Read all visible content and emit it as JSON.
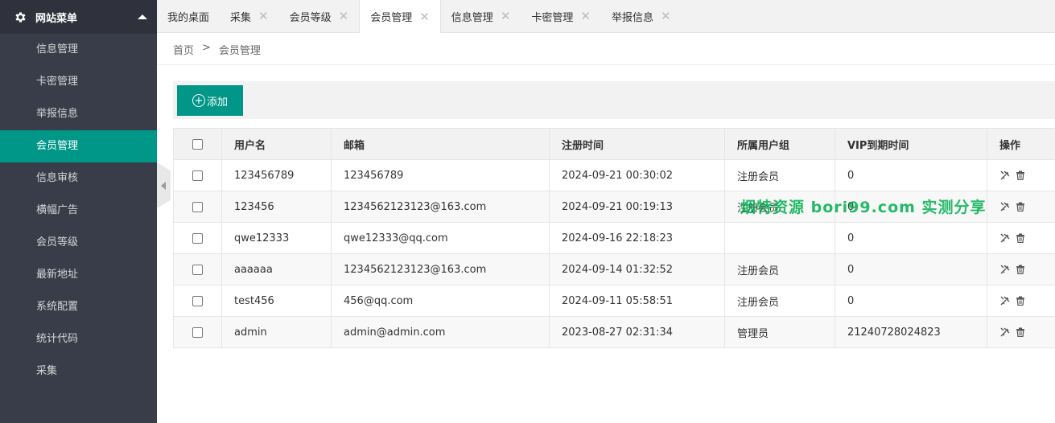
{
  "sidebar": {
    "header": "网站菜单",
    "items": [
      {
        "label": "信息管理",
        "active": false
      },
      {
        "label": "卡密管理",
        "active": false
      },
      {
        "label": "举报信息",
        "active": false
      },
      {
        "label": "会员管理",
        "active": true
      },
      {
        "label": "信息审核",
        "active": false
      },
      {
        "label": "横幅广告",
        "active": false
      },
      {
        "label": "会员等级",
        "active": false
      },
      {
        "label": "最新地址",
        "active": false
      },
      {
        "label": "系统配置",
        "active": false
      },
      {
        "label": "统计代码",
        "active": false
      },
      {
        "label": "采集",
        "active": false
      }
    ]
  },
  "tabs": [
    {
      "label": "我的桌面",
      "closable": false,
      "active": false
    },
    {
      "label": "采集",
      "closable": true,
      "active": false
    },
    {
      "label": "会员等级",
      "closable": true,
      "active": false
    },
    {
      "label": "会员管理",
      "closable": true,
      "active": true
    },
    {
      "label": "信息管理",
      "closable": true,
      "active": false
    },
    {
      "label": "卡密管理",
      "closable": true,
      "active": false
    },
    {
      "label": "举报信息",
      "closable": true,
      "active": false
    }
  ],
  "breadcrumb": {
    "home": "首页",
    "separator": ">",
    "current": "会员管理"
  },
  "toolbar": {
    "add_label": "添加"
  },
  "table": {
    "headers": {
      "username": "用户名",
      "email": "邮箱",
      "reg_time": "注册时间",
      "group": "所属用户组",
      "vip_expire": "VIP到期时间",
      "actions": "操作"
    },
    "rows": [
      {
        "username": "123456789",
        "email": "123456789",
        "reg_time": "2024-09-21 00:30:02",
        "group": "注册会员",
        "vip_expire": "0"
      },
      {
        "username": "123456",
        "email": "1234562123123@163.com",
        "reg_time": "2024-09-21 00:19:13",
        "group": "注册会员",
        "vip_expire": "0"
      },
      {
        "username": "qwe12333",
        "email": "qwe12333@qq.com",
        "reg_time": "2024-09-16 22:18:23",
        "group": "",
        "vip_expire": "0"
      },
      {
        "username": "aaaaaa",
        "email": "1234562123123@163.com",
        "reg_time": "2024-09-14 01:32:52",
        "group": "注册会员",
        "vip_expire": "0"
      },
      {
        "username": "test456",
        "email": "456@qq.com",
        "reg_time": "2024-09-11 05:58:51",
        "group": "注册会员",
        "vip_expire": "0"
      },
      {
        "username": "admin",
        "email": "admin@admin.com",
        "reg_time": "2023-08-27 02:31:34",
        "group": "管理员",
        "vip_expire": "21240728024823"
      }
    ]
  },
  "watermark": "烟特资源 bori99.com 实测分享",
  "colors": {
    "accent": "#009688",
    "sidebar_bg": "#393d49",
    "watermark": "#00b050"
  },
  "icons": {
    "header": "gear-icon",
    "edit": "tools-icon",
    "delete": "trash-icon"
  }
}
